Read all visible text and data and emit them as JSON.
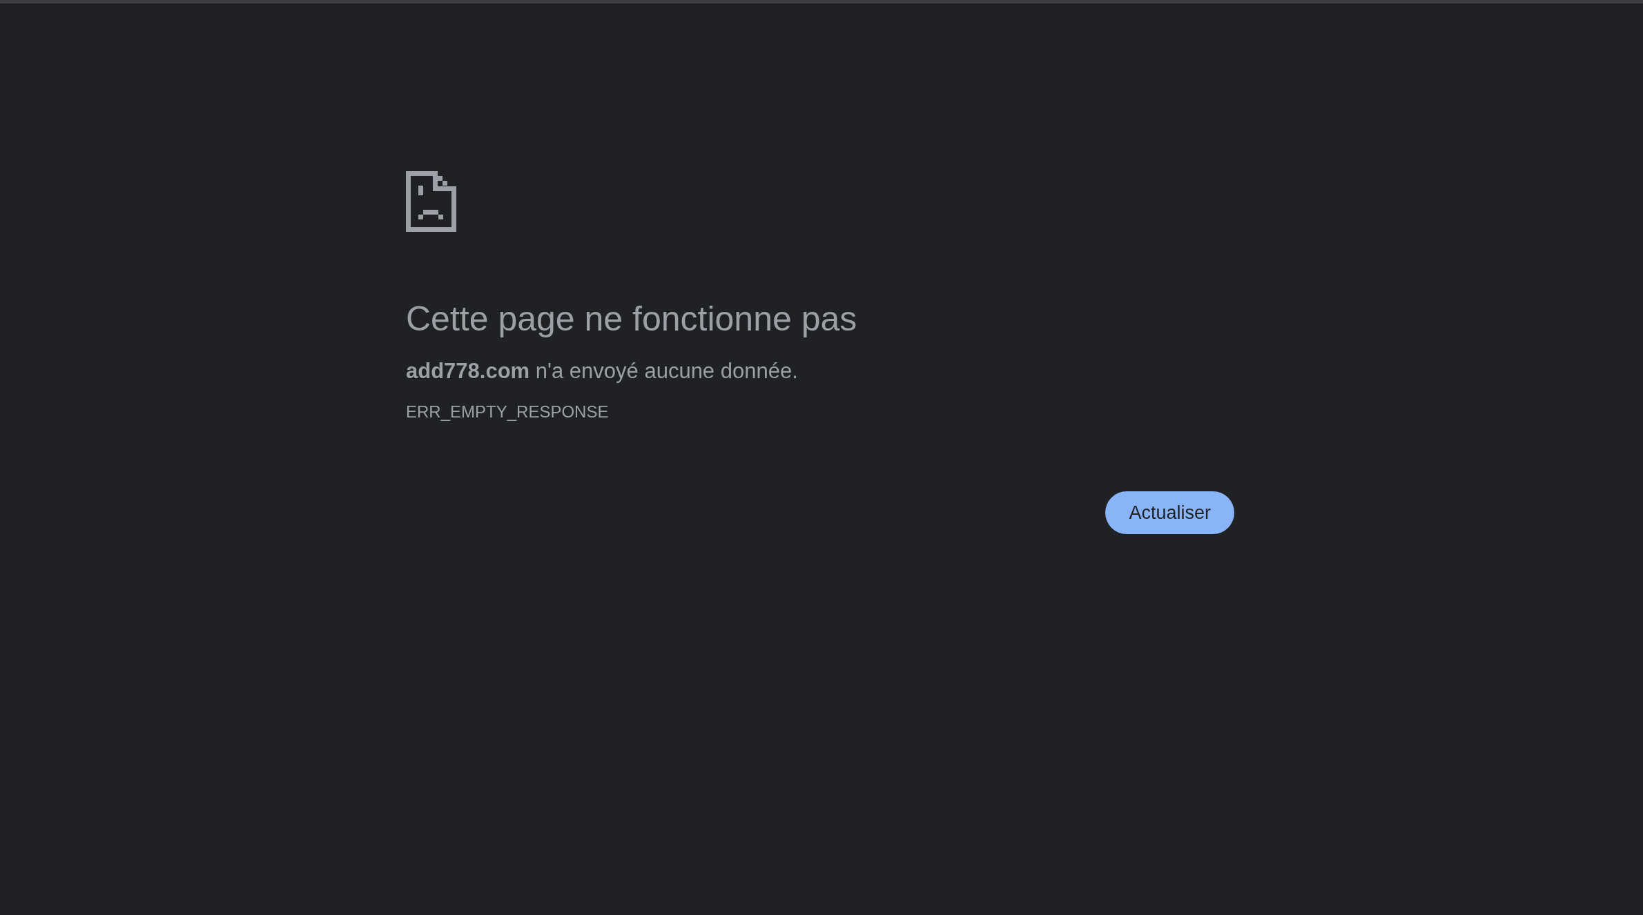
{
  "error": {
    "title": "Cette page ne fonctionne pas",
    "message": "**add778.com** n'a envoyé aucune donnée.",
    "code": "ERR_EMPTY_RESPONSE"
  },
  "buttons": [
    {
      "label": "Actualiser"
    }
  ]
}
